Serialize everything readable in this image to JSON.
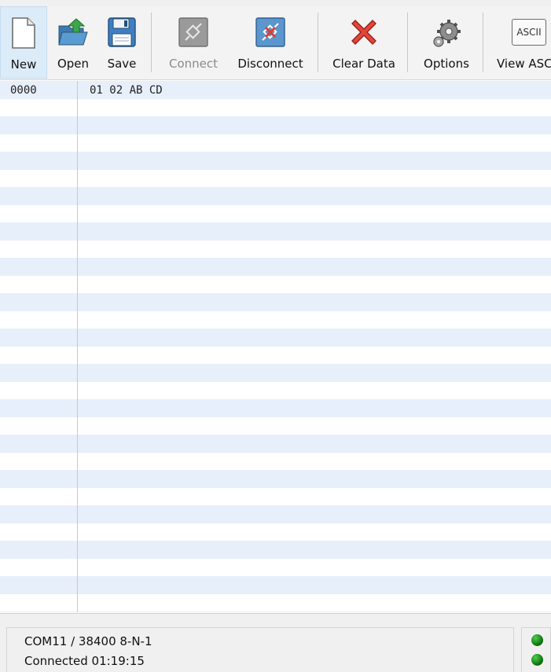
{
  "toolbar": {
    "buttons": [
      {
        "id": "new",
        "label": "New",
        "icon": "new-document-icon",
        "enabled": true,
        "active": true
      },
      {
        "id": "open",
        "label": "Open",
        "icon": "open-folder-icon",
        "enabled": true,
        "active": false
      },
      {
        "id": "save",
        "label": "Save",
        "icon": "floppy-disk-icon",
        "enabled": true,
        "active": false
      },
      {
        "id": "connect",
        "label": "Connect",
        "icon": "plug-connect-icon",
        "enabled": false,
        "active": false
      },
      {
        "id": "disconnect",
        "label": "Disconnect",
        "icon": "plug-disconnect-icon",
        "enabled": true,
        "active": true
      },
      {
        "id": "clear",
        "label": "Clear Data",
        "icon": "red-x-icon",
        "enabled": true,
        "active": false
      },
      {
        "id": "options",
        "label": "Options",
        "icon": "gears-icon",
        "enabled": true,
        "active": false
      },
      {
        "id": "view_ascii",
        "label": "View ASC",
        "icon": "ascii-icon",
        "icon_text": "ASCII",
        "enabled": true,
        "active": false
      }
    ]
  },
  "data_view": {
    "rows": [
      {
        "address": "0000",
        "bytes": "01 02 AB CD"
      }
    ],
    "stripe_color": "#e7effb"
  },
  "status": {
    "port_settings": "COM11 / 38400 8-N-1",
    "connection": "Connected 01:19:15",
    "led_color": "#0c8a0c"
  }
}
